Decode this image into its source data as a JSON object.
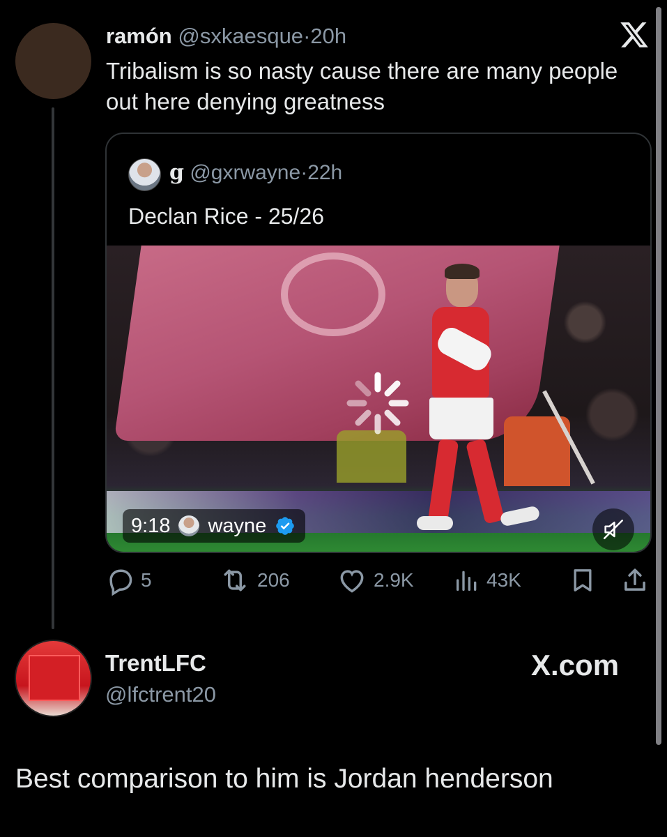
{
  "tweet": {
    "author_name": "ramón",
    "author_handle": "@sxkaesque",
    "separator": "·",
    "time": "20h",
    "text": "Tribalism is so nasty cause there are many people out here denying greatness",
    "avatar_color": "#3b2a1f"
  },
  "quoted_tweet": {
    "author_name": "g",
    "author_handle": "@gxrwayne",
    "separator": "·",
    "time": "22h",
    "text": "Declan Rice - 25/26",
    "video": {
      "duration": "9:18",
      "uploader": "wayne",
      "verified": true,
      "loading_icon": "spinner-icon",
      "mute_icon": "muted-speaker-icon"
    }
  },
  "actions": {
    "reply_count": "5",
    "retweet_count": "206",
    "like_count": "2.9K",
    "view_count": "43K",
    "icons": [
      "reply-icon",
      "retweet-icon",
      "like-icon",
      "views-icon",
      "bookmark-icon",
      "share-icon"
    ]
  },
  "reply": {
    "author_name": "TrentLFC",
    "author_handle": "@lfctrent20",
    "source_label": "X.com",
    "text": "Best comparison to him is Jordan henderson"
  },
  "colors": {
    "background": "#000000",
    "primary_text": "#e7e9ea",
    "secondary_text": "#8b98a5",
    "border": "#2f3336",
    "verified_blue": "#1d9bf0"
  }
}
